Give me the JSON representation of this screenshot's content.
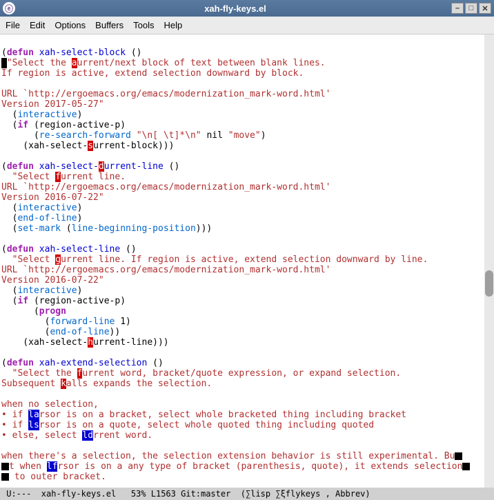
{
  "window": {
    "title": "xah-fly-keys.el",
    "app_icon_glyph": "ⓔ"
  },
  "menu": {
    "file": "File",
    "edit": "Edit",
    "options": "Options",
    "buffers": "Buffers",
    "tools": "Tools",
    "help": "Help"
  },
  "code": {
    "defun": "defun",
    "if_kw": "if",
    "progn": "progn",
    "fn_select_block": "xah-select-block",
    "fn_select_durrent_line": "xah-select-",
    "fn_select_durrent_line_suffix": "urrent-line",
    "fn_select_line": "xah-select-line",
    "fn_extend_selection": "xah-extend-selection",
    "interactive": "interactive",
    "region_active_p": "region-active-p",
    "re_search_forward": "re-search-forward",
    "re_arg1": "\"\\n[ \\t]*\\n\"",
    "nil": "nil",
    "move": "\"move\"",
    "xah_select_surrent_block": "xah-select-",
    "xah_select_surrent_block_suffix": "urrent-block",
    "end_of_line": "end-of-line",
    "set_mark": "set-mark",
    "line_beginning_position": "line-beginning-position",
    "forward_line": "forward-line",
    "one": "1",
    "xah_select_hurrent_line": "xah-select-",
    "xah_select_hurrent_line_suffix": "urrent-line",
    "doc1_a": "\"Select the ",
    "doc1_b": "urrent/next block of text between blank lines.",
    "doc1_c": "If region is active, extend selection downward by block.",
    "doc_url": "URL `http://ergoemacs.org/emacs/modernization_mark-word.html'",
    "doc_ver1": "Version 2017-05-27\"",
    "doc2_a": "\"Select ",
    "doc2_b": "urrent line.",
    "doc_ver2": "Version 2016-07-22\"",
    "doc3_a": "\"Select ",
    "doc3_b": "urrent line. If region is active, extend selection downward by line.",
    "doc4_a": "\"Select the ",
    "doc4_b": "urrent word, bracket/quote expression, or expand selection.",
    "doc4_c": "Subsequent ",
    "doc4_d": "alls expands the selection.",
    "doc5_a": "when no selection,",
    "doc5_b": "• if ",
    "doc5_c": "rsor is on a bracket, select whole bracketed thing including bracket",
    "doc5_d": "rsor is on a quote, select whole quoted thing including quoted",
    "doc5_e": "• else, select ",
    "doc5_f": "rrent word.",
    "doc6_a": "when there's a selection, the selection extension behavior is still experimental. Bu",
    "doc6_b": "t when ",
    "doc6_c": "rsor is on a any type of bracket (parenthesis, quote), it extends selection",
    "doc6_d": " to outer bracket.",
    "hl_a": "a",
    "hl_d": "d",
    "hl_f": "f",
    "hl_g": "g",
    "hl_h": "h",
    "hl_k": "k",
    "hl_s": "s",
    "hl_la": "la",
    "hl_ls": "ls",
    "hl_ld": "ld",
    "hl_lf": "lf"
  },
  "modeline": {
    "left": " U:---  xah-fly-keys.el   53% L1563 Git:master  (∑lisp ∑ξflykeys , Abbrev)"
  }
}
